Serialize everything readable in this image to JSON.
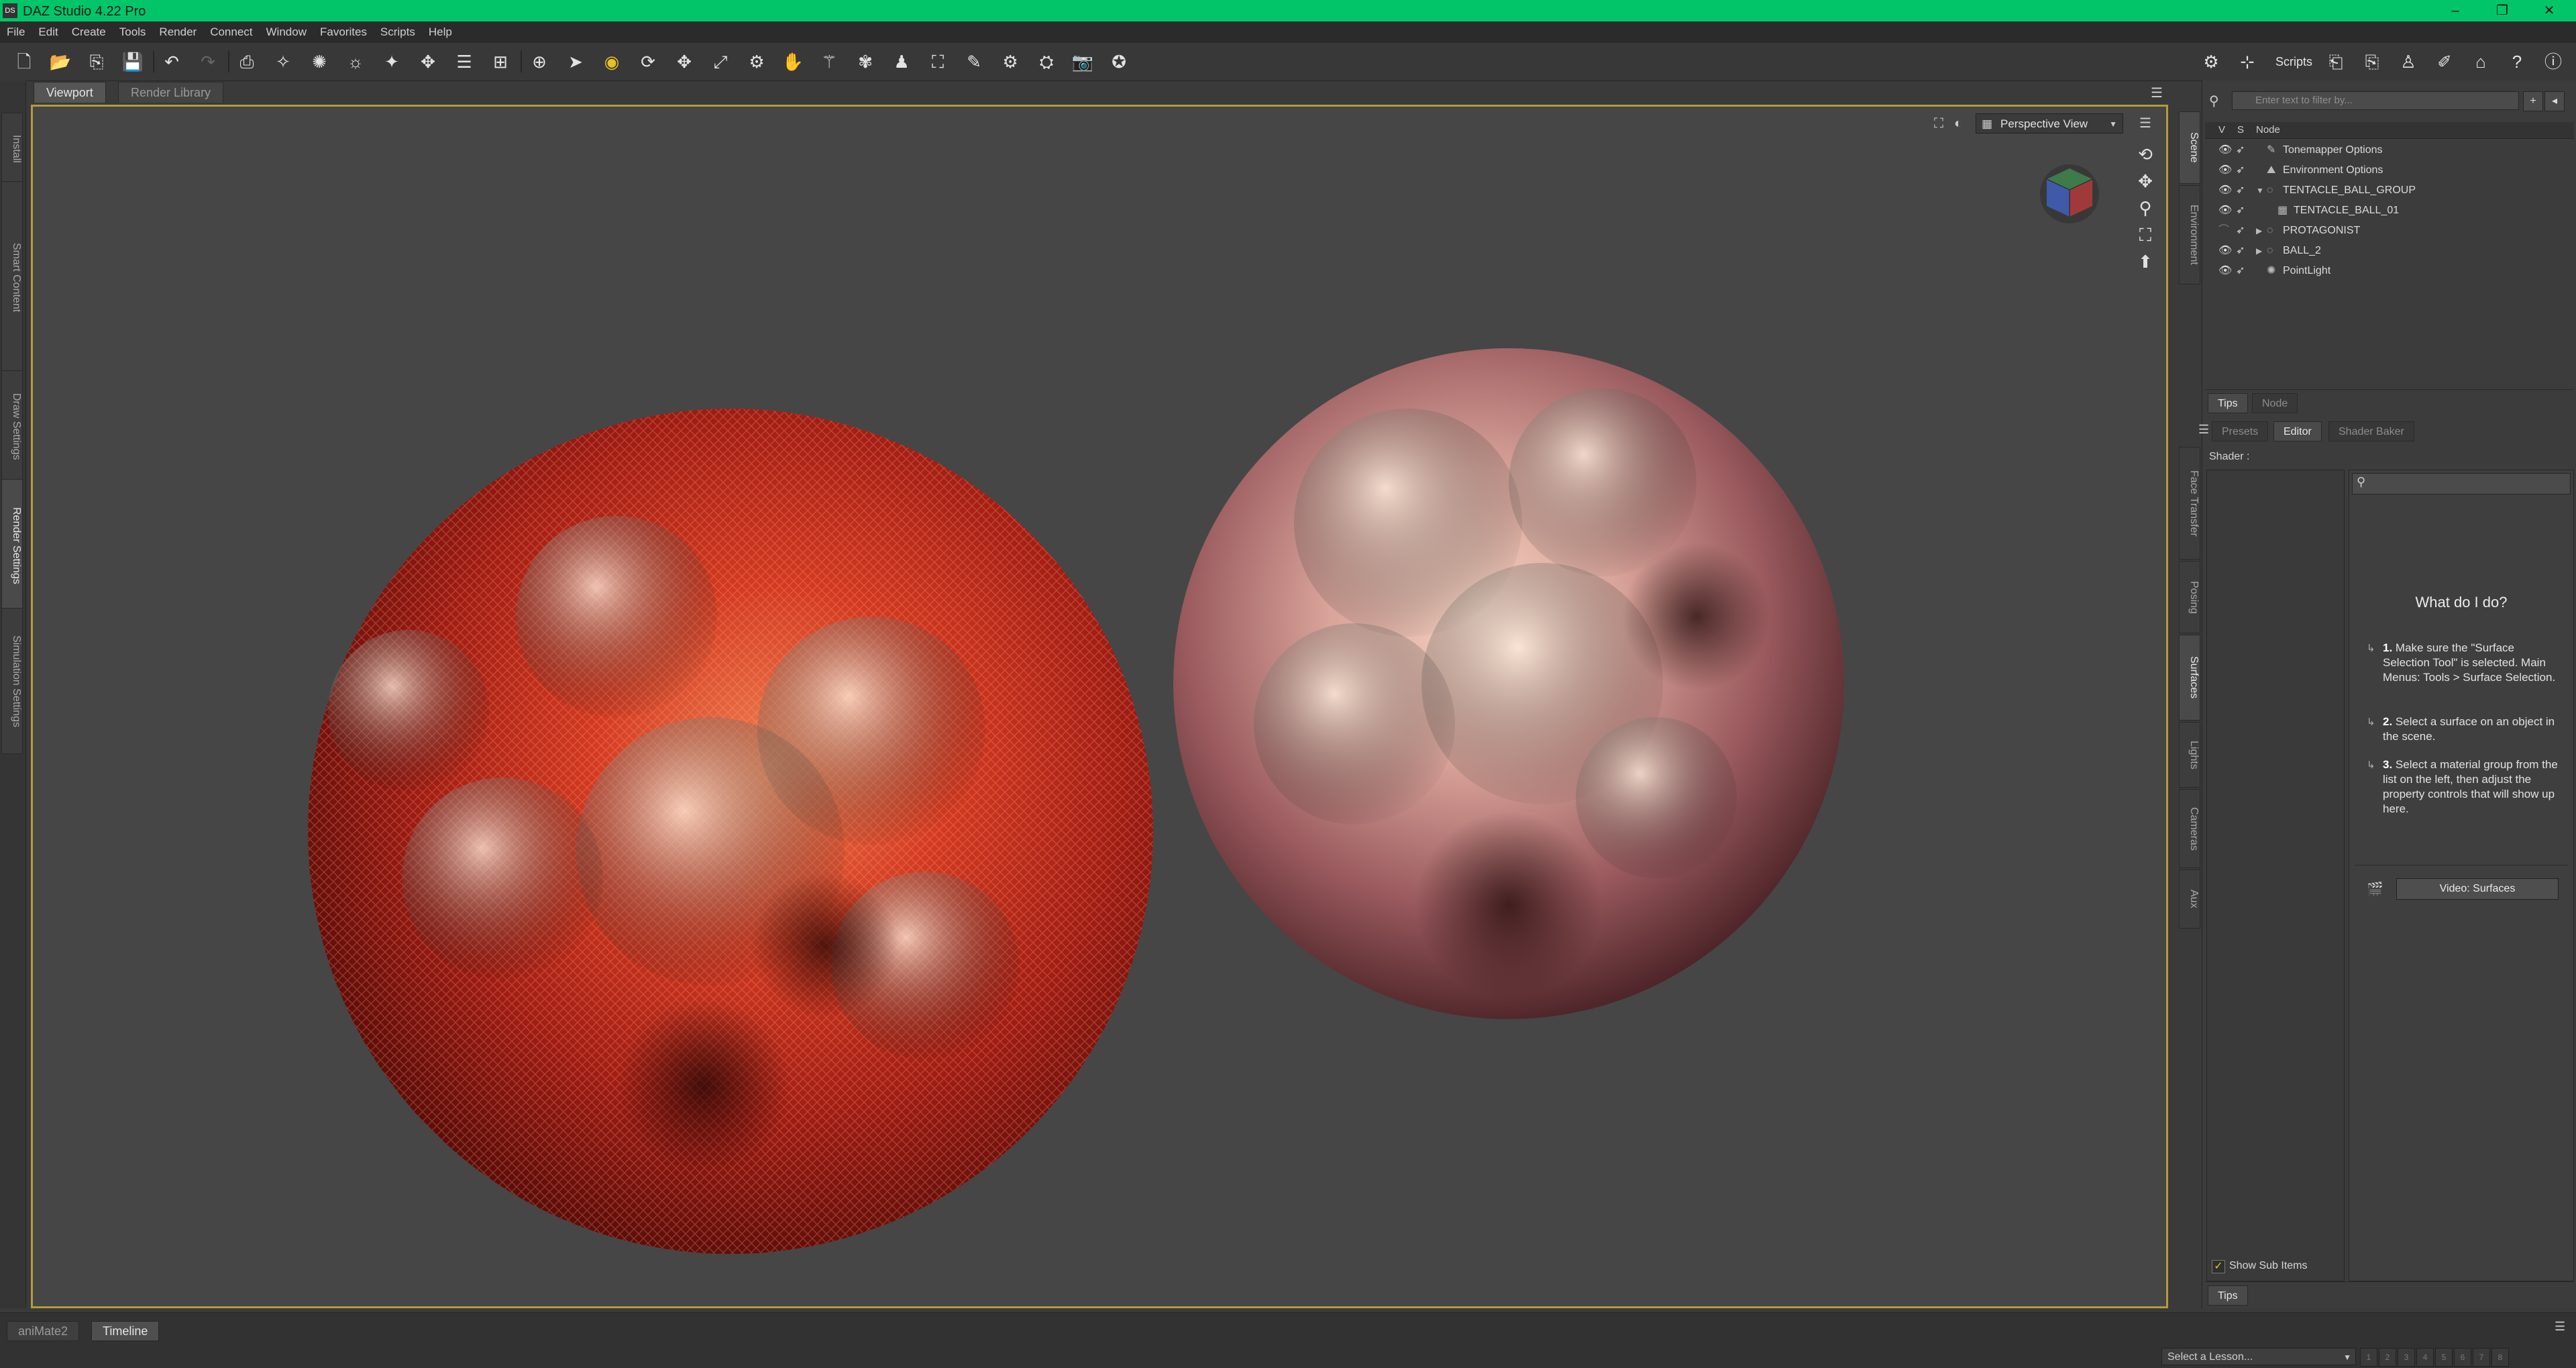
{
  "window": {
    "title": "DAZ Studio 4.22 Pro",
    "app_icon_text": "DS",
    "controls": [
      "–",
      "❐",
      "✕"
    ],
    "accent_color": "#02c56a"
  },
  "menu": [
    "File",
    "Edit",
    "Create",
    "Tools",
    "Render",
    "Connect",
    "Window",
    "Favorites",
    "Scripts",
    "Help"
  ],
  "toolbar": {
    "scripts_label": "Scripts"
  },
  "left_tabs": [
    "Install",
    "Smart Content",
    "Draw Settings",
    "Render Settings",
    "Simulation Settings"
  ],
  "view_tabs": [
    "Viewport",
    "Render Library"
  ],
  "viewport": {
    "camera": "Perspective View",
    "border_color": "#b49a3e"
  },
  "right_tabs": [
    "Scene",
    "Environment",
    "Face Transfer",
    "Posing",
    "Surfaces",
    "Lights",
    "Cameras",
    "Aux"
  ],
  "scene": {
    "filter_placeholder": "Enter text to filter by...",
    "columns": [
      "V",
      "S",
      "Node"
    ],
    "nodes": [
      {
        "label": "Tonemapper Options"
      },
      {
        "label": "Environment Options"
      },
      {
        "label": "TENTACLE_BALL_GROUP"
      },
      {
        "label": "TENTACLE_BALL_01"
      },
      {
        "label": "PROTAGONIST"
      },
      {
        "label": "BALL_2"
      },
      {
        "label": "PointLight"
      }
    ],
    "tabs": [
      "Tips",
      "Node"
    ]
  },
  "surfaces": {
    "tabs": [
      "Presets",
      "Editor",
      "Shader Baker"
    ],
    "shader_label": "Shader :",
    "help_title": "What do I do?",
    "steps": [
      {
        "num": "1.",
        "text": "Make sure the \"Surface Selection Tool\" is selected. Main Menus: Tools > Surface Selection."
      },
      {
        "num": "2.",
        "text": "Select a surface on an object in the scene."
      },
      {
        "num": "3.",
        "text": "Select a material group from the list on the left, then adjust the property controls that will show up here."
      }
    ],
    "video_button": "Video: Surfaces",
    "show_sub_items": "Show Sub Items",
    "show_sub_items_checked": true,
    "bottom_tab": "Tips"
  },
  "bottom": {
    "tabs": [
      "aniMate2",
      "Timeline"
    ],
    "lesson_select": "Select a Lesson...",
    "lesson_steps": [
      "1",
      "2",
      "3",
      "4",
      "5",
      "6",
      "7",
      "8"
    ]
  }
}
